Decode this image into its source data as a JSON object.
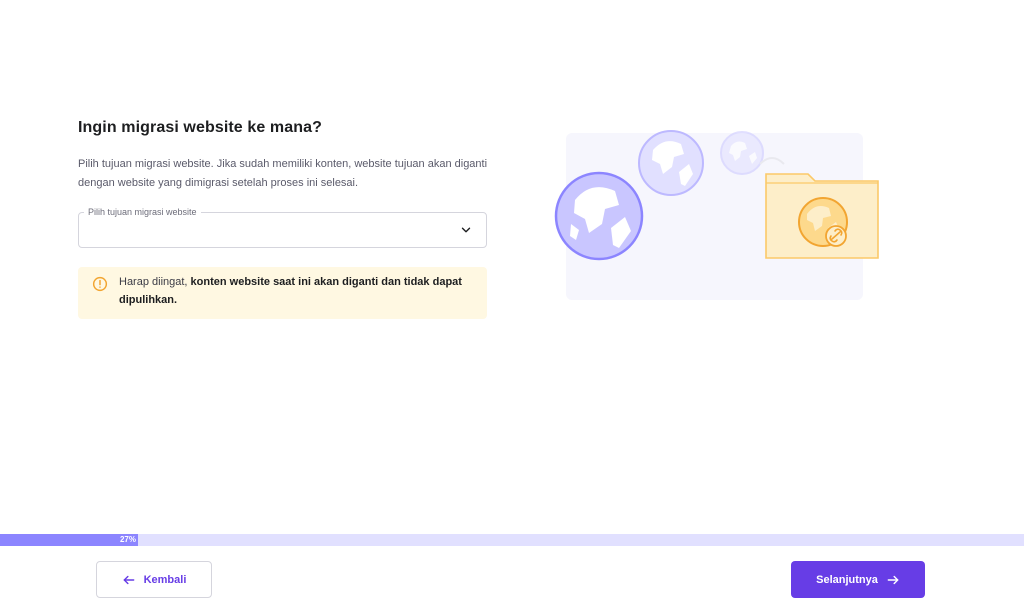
{
  "page": {
    "title": "Ingin migrasi website ke mana?",
    "description": "Pilih tujuan migrasi website. Jika sudah memiliki konten, website tujuan akan diganti dengan website yang dimigrasi setelah proses ini selesai."
  },
  "select": {
    "label": "Pilih tujuan migrasi website",
    "value": "",
    "icon": "chevron-down-icon"
  },
  "alert": {
    "icon": "warning-circle-icon",
    "prefix": "Harap diingat, ",
    "bold": "konten website saat ini akan diganti dan tidak dapat dipulihkan."
  },
  "progress": {
    "percent": 27,
    "label": "27%"
  },
  "footer": {
    "back_label": "Kembali",
    "next_label": "Selanjutnya"
  },
  "colors": {
    "primary": "#673de6",
    "progress_fill": "#8c85ff",
    "progress_track": "#e1e0ff",
    "alert_bg": "#fff8e2",
    "alert_icon": "#f2a531"
  }
}
